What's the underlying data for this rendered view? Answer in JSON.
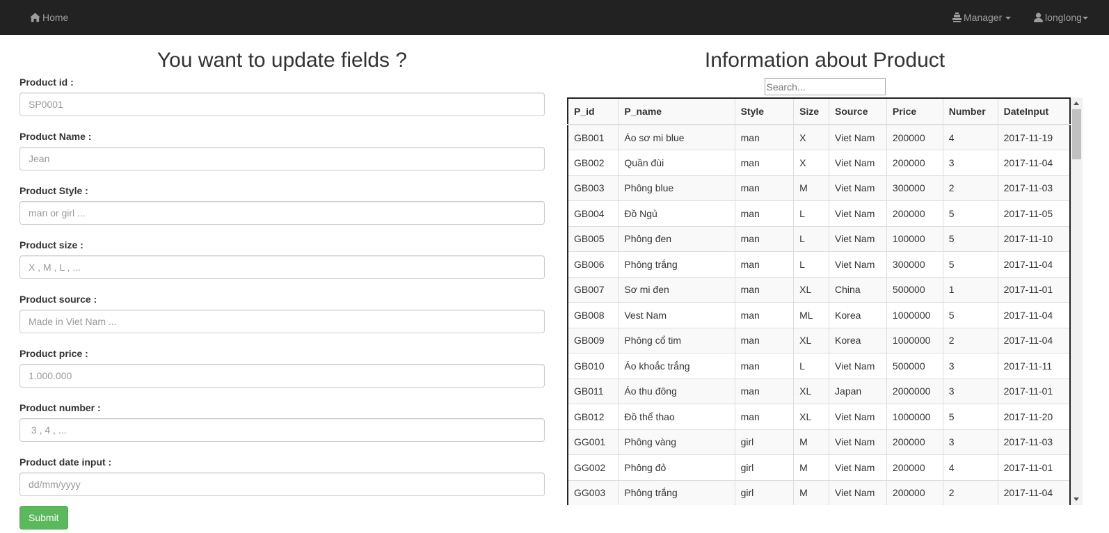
{
  "navbar": {
    "home_label": "Home",
    "manager_label": "Manager",
    "user_label": "longlong"
  },
  "form": {
    "title": "You want to update fields ?",
    "fields": [
      {
        "label": "Product id :",
        "placeholder": "SP0001"
      },
      {
        "label": "Product Name :",
        "placeholder": "Jean"
      },
      {
        "label": "Product Style :",
        "placeholder": "man or girl ..."
      },
      {
        "label": "Product size :",
        "placeholder": "X , M , L , ..."
      },
      {
        "label": "Product source :",
        "placeholder": "Made in Viet Nam ..."
      },
      {
        "label": "Product price :",
        "placeholder": "1.000.000"
      },
      {
        "label": "Product number :",
        "placeholder": " 3 , 4 , ..."
      },
      {
        "label": "Product date input :",
        "placeholder": "dd/mm/yyyy"
      }
    ],
    "submit_label": "Submit"
  },
  "product_info": {
    "title": "Information about Product",
    "search_placeholder": "Search...",
    "columns": [
      "P_id",
      "P_name",
      "Style",
      "Size",
      "Source",
      "Price",
      "Number",
      "DateInput"
    ],
    "rows": [
      [
        "GB001",
        "Áo sơ mi blue",
        "man",
        "X",
        "Viet Nam",
        "200000",
        "4",
        "2017-11-19"
      ],
      [
        "GB002",
        "Quần đùi",
        "man",
        "X",
        "Viet Nam",
        "200000",
        "3",
        "2017-11-04"
      ],
      [
        "GB003",
        "Phông blue",
        "man",
        "M",
        "Viet Nam",
        "300000",
        "2",
        "2017-11-03"
      ],
      [
        "GB004",
        "Đồ Ngủ",
        "man",
        "L",
        "Viet Nam",
        "200000",
        "5",
        "2017-11-05"
      ],
      [
        "GB005",
        "Phông đen",
        "man",
        "L",
        "Viet Nam",
        "100000",
        "5",
        "2017-11-10"
      ],
      [
        "GB006",
        "Phông trắng",
        "man",
        "L",
        "Viet Nam",
        "300000",
        "5",
        "2017-11-04"
      ],
      [
        "GB007",
        "Sơ mi đen",
        "man",
        "XL",
        "China",
        "500000",
        "1",
        "2017-11-01"
      ],
      [
        "GB008",
        "Vest Nam",
        "man",
        "ML",
        "Korea",
        "1000000",
        "5",
        "2017-11-04"
      ],
      [
        "GB009",
        "Phông cổ tim",
        "man",
        "XL",
        "Korea",
        "1000000",
        "2",
        "2017-11-04"
      ],
      [
        "GB010",
        "Áo khoắc trắng",
        "man",
        "L",
        "Viet Nam",
        "500000",
        "3",
        "2017-11-11"
      ],
      [
        "GB011",
        "Áo thu đông",
        "man",
        "XL",
        "Japan",
        "2000000",
        "3",
        "2017-11-01"
      ],
      [
        "GB012",
        "Đồ thể thao",
        "man",
        "XL",
        "Viet Nam",
        "1000000",
        "5",
        "2017-11-20"
      ],
      [
        "GG001",
        "Phông vàng",
        "girl",
        "M",
        "Viet Nam",
        "200000",
        "3",
        "2017-11-03"
      ],
      [
        "GG002",
        "Phông đỏ",
        "girl",
        "M",
        "Viet Nam",
        "200000",
        "4",
        "2017-11-01"
      ],
      [
        "GG003",
        "Phông trắng",
        "girl",
        "M",
        "Viet Nam",
        "200000",
        "2",
        "2017-11-04"
      ]
    ]
  },
  "colors": {
    "navbar_bg": "#222222",
    "nav_text": "#9d9d9d",
    "submit_bg": "#5cb85c"
  },
  "icons": {
    "home": "home-icon",
    "manager": "manager-icon",
    "user": "user-icon"
  }
}
